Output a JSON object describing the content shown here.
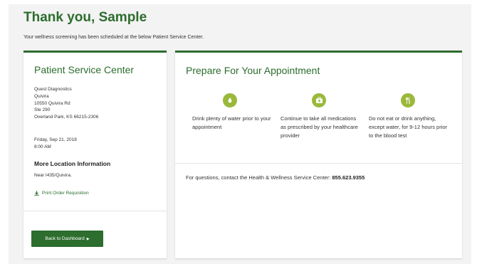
{
  "header": {
    "title": "Thank you, Sample",
    "subtitle": "Your wellness screening has been scheduled at the below Patient Service Center."
  },
  "psc": {
    "heading": "Patient Service Center",
    "address_lines": [
      "Quest Diagnostics",
      "Quivira",
      "10550 Quivira Rd",
      "Ste 290",
      "Overland Park, KS 66215-2306"
    ],
    "date": "Friday, Sep 21, 2018",
    "time": "8:00 AM",
    "more_info_heading": "More Location Information",
    "near": "Near I435/Quivira.",
    "print_link": "Print Order Requisition",
    "back_button": "Back to Dashboard"
  },
  "prepare": {
    "heading": "Prepare For Your Appointment",
    "tips": [
      {
        "icon": "water-drop-icon",
        "text": "Drink plenty of water prior to your appointment"
      },
      {
        "icon": "medical-kit-icon",
        "text": "Continue to take all medications as prescribed by your healthcare provider"
      },
      {
        "icon": "utensils-icon",
        "text": "Do not eat or drink anything, except water, for 9-12 hours prior to the blood test"
      }
    ],
    "questions_text": "For questions, contact the Health & Wellness Service Center:",
    "phone": "855.623.9355"
  },
  "colors": {
    "brand_green": "#2d6d2e",
    "icon_green": "#9ab93b"
  }
}
